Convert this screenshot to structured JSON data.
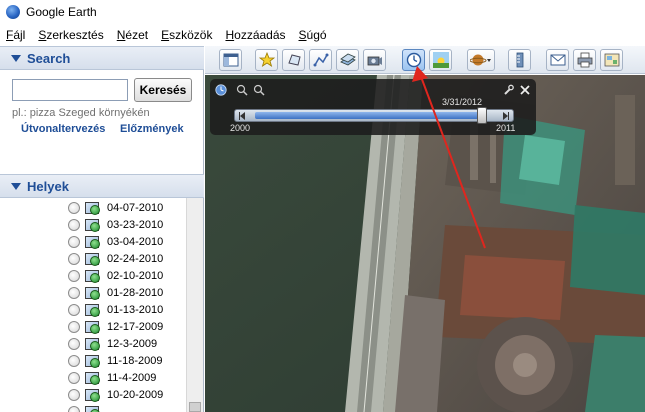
{
  "window": {
    "title": "Google Earth"
  },
  "menu": {
    "items": [
      {
        "ul": "F",
        "rest": "ájl"
      },
      {
        "ul": "S",
        "rest": "zerkesztés"
      },
      {
        "ul": "N",
        "rest": "ézet"
      },
      {
        "ul": "E",
        "rest": "szközök"
      },
      {
        "ul": "H",
        "rest": "ozzáadás"
      },
      {
        "ul": "S",
        "rest": "úgó"
      }
    ]
  },
  "search_panel": {
    "title": "Search",
    "input_value": "",
    "button_label": "Keresés",
    "hint": "pl.: pizza Szeged környékén",
    "link_directions": "Útvonaltervezés",
    "link_history": "Előzmények"
  },
  "places_panel": {
    "title": "Helyek",
    "items": [
      "04-07-2010",
      "03-23-2010",
      "03-04-2010",
      "02-24-2010",
      "02-10-2010",
      "01-28-2010",
      "01-13-2010",
      "12-17-2009",
      "12-3-2009",
      "11-18-2009",
      "11-4-2009",
      "10-20-2009",
      ""
    ]
  },
  "toolbar": {
    "buttons": [
      "sidebar-toggle",
      "add-placemark",
      "add-polygon",
      "add-path",
      "add-image-overlay",
      "record-tour",
      "historical-imagery",
      "sunlight",
      "switch-planet",
      "ruler",
      "email",
      "print",
      "view-in-maps"
    ],
    "active": "historical-imagery"
  },
  "time_slider": {
    "current_date": "3/31/2012",
    "start_year": "2000",
    "end_year": "2011",
    "position_fraction": 0.92
  },
  "colors": {
    "link": "#1f4e97",
    "panel_header": "#d6dfec",
    "annotation_arrow": "#e0261e",
    "slider_range": "#3d72c3"
  }
}
